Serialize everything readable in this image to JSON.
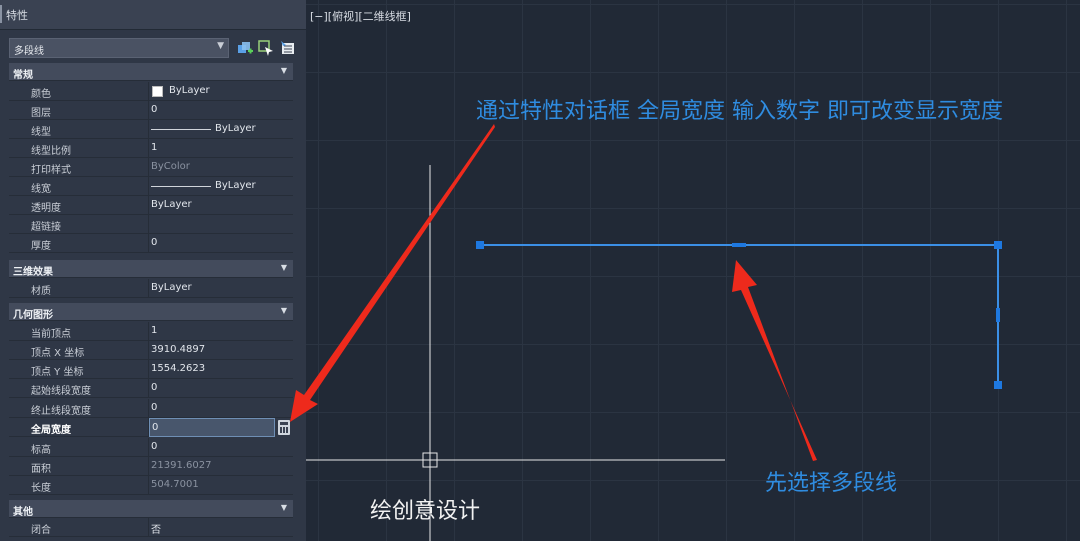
{
  "panel": {
    "title": "特性",
    "object_type": "多段线",
    "sections": {
      "general": "常规",
      "three_d": "三维效果",
      "geometry": "几何图形",
      "misc": "其他"
    },
    "general_rows": [
      {
        "key": "颜色",
        "value": "ByLayer"
      },
      {
        "key": "图层",
        "value": "0"
      },
      {
        "key": "线型",
        "value": "ByLayer"
      },
      {
        "key": "线型比例",
        "value": "1"
      },
      {
        "key": "打印样式",
        "value": "ByColor"
      },
      {
        "key": "线宽",
        "value": "ByLayer"
      },
      {
        "key": "透明度",
        "value": "ByLayer"
      },
      {
        "key": "超链接",
        "value": ""
      },
      {
        "key": "厚度",
        "value": "0"
      }
    ],
    "three_d_rows": [
      {
        "key": "材质",
        "value": "ByLayer"
      }
    ],
    "geometry_rows": [
      {
        "key": "当前顶点",
        "value": "1"
      },
      {
        "key": "顶点 X 坐标",
        "value": "3910.4897"
      },
      {
        "key": "顶点 Y 坐标",
        "value": "1554.2623"
      },
      {
        "key": "起始线段宽度",
        "value": "0"
      },
      {
        "key": "终止线段宽度",
        "value": "0"
      },
      {
        "key": "全局宽度",
        "value": "0"
      },
      {
        "key": "标高",
        "value": "0"
      },
      {
        "key": "面积",
        "value": "21391.6027"
      },
      {
        "key": "长度",
        "value": "504.7001"
      }
    ],
    "misc_rows": [
      {
        "key": "闭合",
        "value": "否"
      }
    ]
  },
  "canvas": {
    "viewport_label": "[−][俯视][二维线框]"
  },
  "annotations": {
    "top": "通过特性对话框 全局宽度 输入数字 即可改变显示宽度",
    "bottom": "先选择多段线",
    "watermark": "绘创意设计"
  },
  "colors": {
    "annotation_blue": "#2f8ce0",
    "arrow_red": "#ee2a1c",
    "polyline_blue": "#3b8fe6",
    "grip_blue": "#1e78e0"
  }
}
